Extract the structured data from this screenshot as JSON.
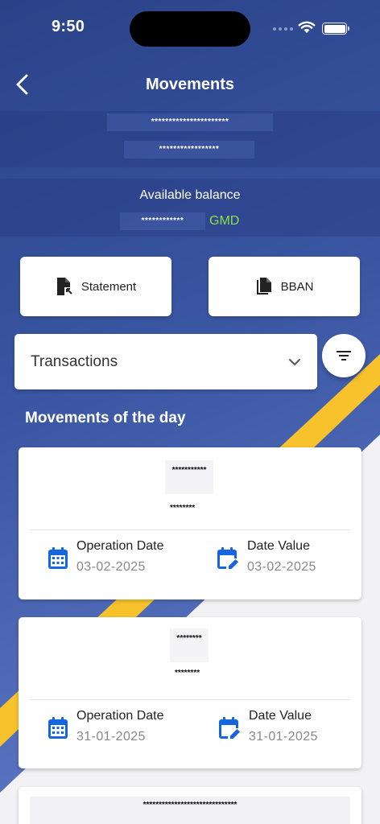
{
  "status_bar": {
    "time": "9:50"
  },
  "header": {
    "title": "Movements"
  },
  "account": {
    "masked_line1": "**********************",
    "masked_line2": "*****************",
    "available_label": "Available balance",
    "masked_balance": "************",
    "currency": "GMD"
  },
  "actions": {
    "statement_label": "Statement",
    "bban_label": "BBAN"
  },
  "filter": {
    "selected": "Transactions"
  },
  "section": {
    "title": "Movements of the day"
  },
  "movements": [
    {
      "masked_title": "***********",
      "masked_amount": "********",
      "operation_label": "Operation Date",
      "operation_date": "03-02-2025",
      "value_label": "Date Value",
      "value_date": "03-02-2025"
    },
    {
      "masked_title": "********",
      "masked_amount": "********",
      "operation_label": "Operation Date",
      "operation_date": "31-01-2025",
      "value_label": "Date Value",
      "value_date": "31-01-2025"
    },
    {
      "masked_title": "******************************"
    }
  ],
  "colors": {
    "primary_blue": "#2b4690",
    "accent_yellow": "#f7c22b",
    "currency_green": "#8de04a",
    "icon_blue": "#1565e0"
  }
}
